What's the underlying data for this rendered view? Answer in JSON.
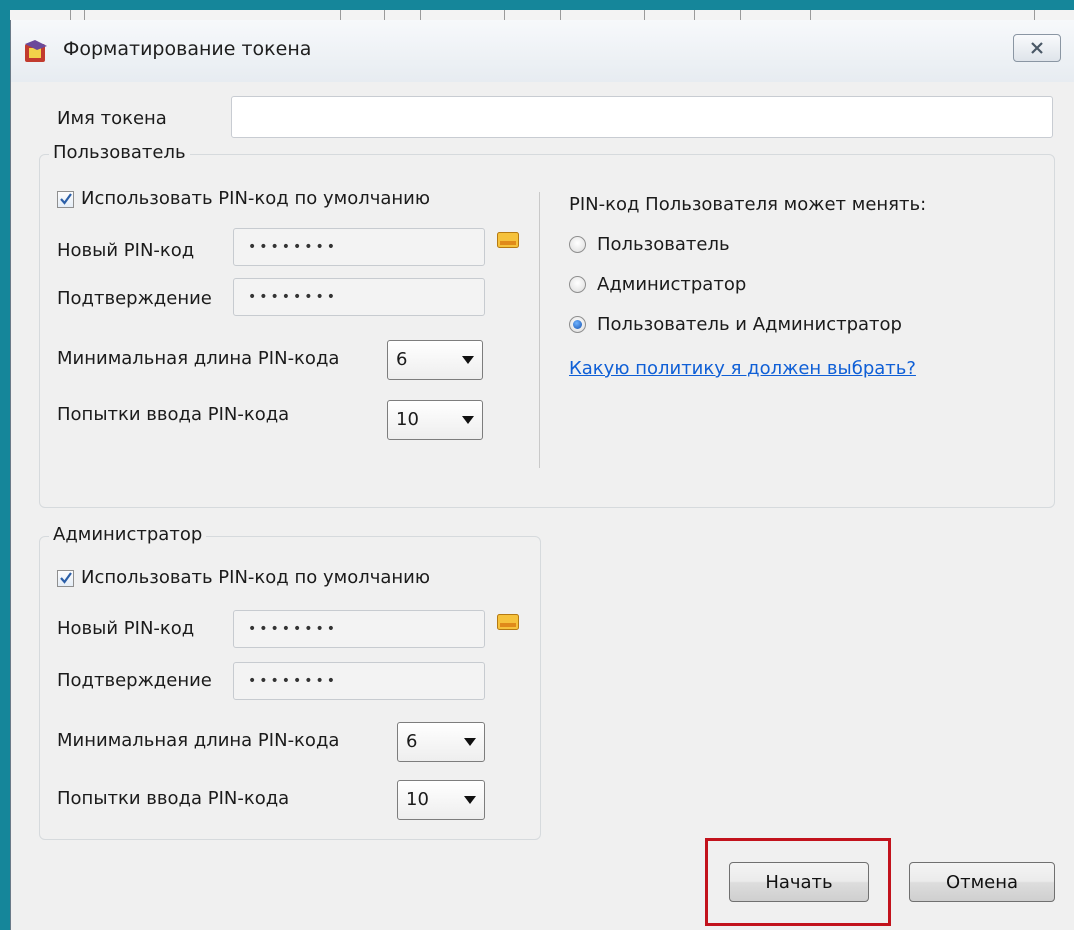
{
  "window": {
    "title": "Форматирование токена"
  },
  "token": {
    "name_label": "Имя токена",
    "name_value": ""
  },
  "user_group": {
    "legend": "Пользователь",
    "use_default_label": "Использовать PIN-код по умолчанию",
    "use_default_checked": true,
    "new_pin_label": "Новый PIN-код",
    "new_pin_value": "••••••••",
    "confirm_label": "Подтверждение",
    "confirm_value": "••••••••",
    "min_length_label": "Минимальная длина PIN-кода",
    "min_length_value": "6",
    "attempts_label": "Попытки ввода PIN-кода",
    "attempts_value": "10"
  },
  "pin_policy": {
    "heading": "PIN-код Пользователя может менять:",
    "options": [
      "Пользователь",
      "Администратор",
      "Пользователь и Администратор"
    ],
    "selected_index": 2,
    "help_link": "Какую политику я должен выбрать?"
  },
  "admin_group": {
    "legend": "Администратор",
    "use_default_label": "Использовать PIN-код по умолчанию",
    "use_default_checked": true,
    "new_pin_label": "Новый PIN-код",
    "new_pin_value": "••••••••",
    "confirm_label": "Подтверждение",
    "confirm_value": "••••••••",
    "min_length_label": "Минимальная длина PIN-кода",
    "min_length_value": "6",
    "attempts_label": "Попытки ввода PIN-кода",
    "attempts_value": "10"
  },
  "buttons": {
    "start": "Начать",
    "cancel": "Отмена"
  },
  "colors": {
    "frame": "#15869a",
    "link": "#0f5fd6",
    "highlight": "#c2121c",
    "radio_selected": "#1753b0"
  }
}
